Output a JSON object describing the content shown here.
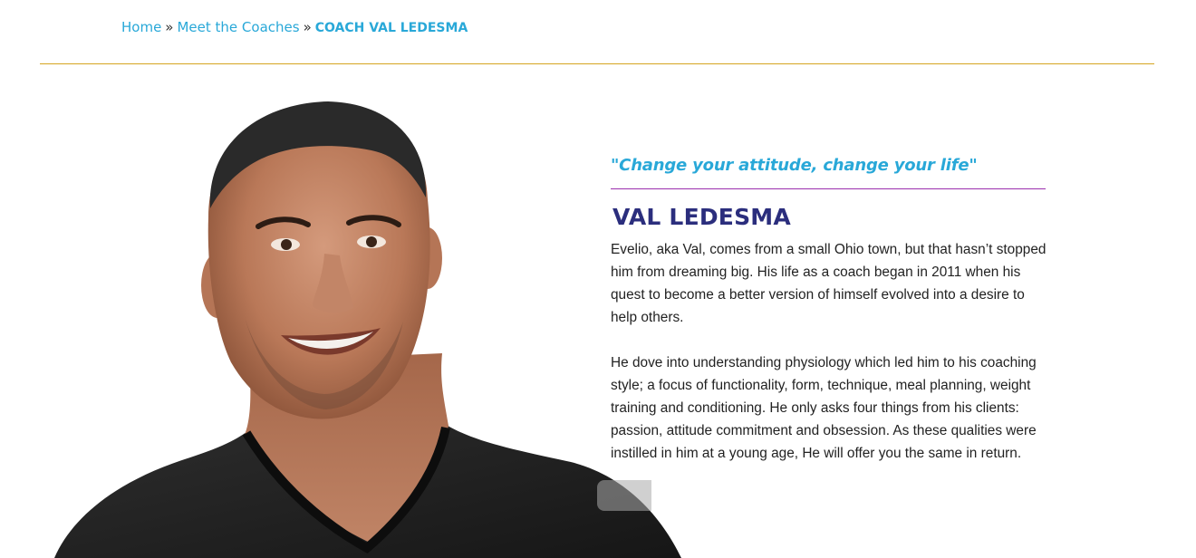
{
  "breadcrumb": {
    "home": "Home",
    "separator_1": "»",
    "meet_coaches": "Meet the Coaches",
    "separator_2": "»",
    "current": "COACH VAL LEDESMA"
  },
  "coach": {
    "quote": "\"Change your attitude, change your life\"",
    "name": "VAL LEDESMA",
    "bio_paragraphs": [
      "Evelio, aka Val, comes from a small Ohio town, but that hasn’t stopped him from dreaming big. His life as a coach began in 2011 when his quest to become a better version of himself evolved into a desire to help others.",
      "He dove into understanding physiology which led him to his coaching style; a focus of functionality, form, technique, meal planning, weight training and conditioning. He only asks four things from his clients: passion, attitude commitment and obsession. As these qualities were instilled in him at a young age, He will offer you the same in return."
    ]
  },
  "colors": {
    "link": "#29a8d8",
    "name": "#2b2e7d",
    "quote_rule": "#9b2fae",
    "top_rule": "#d6a520"
  },
  "icons": {
    "slider_control": "slider-arrow-icon"
  }
}
